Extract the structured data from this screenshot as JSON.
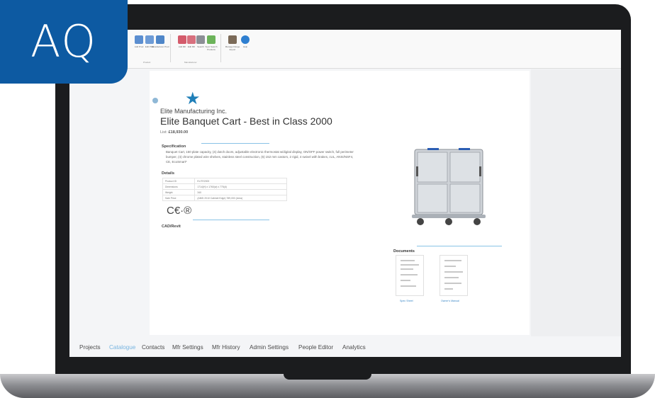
{
  "logo": {
    "text": "AQ",
    "color": "#0d5aa2"
  },
  "ribbon": {
    "buttons": [
      {
        "label": "Add Prod",
        "icon": "catalogue-icon"
      },
      {
        "label": "Edit Prod",
        "icon": "catalogue-icon"
      },
      {
        "label": "Manufacturer Prod",
        "icon": "catalogue-icon"
      },
      {
        "label": "Add Mfr",
        "icon": "cart-icon"
      },
      {
        "label": "Edit Mfr",
        "icon": "cart-icon"
      },
      {
        "label": "Search",
        "icon": "cart-icon"
      },
      {
        "label": "Sync Search Products",
        "icon": "user-search-icon"
      },
      {
        "label": "Manage Range Export",
        "icon": "person-icon"
      },
      {
        "label": "Help",
        "icon": "help-icon"
      }
    ],
    "groups": [
      "Product",
      "Manufacturer"
    ]
  },
  "product": {
    "manufacturer": "Elite Manufacturing Inc.",
    "title": "Elite Banquet Cart - Best in Class 2000",
    "price_label": "List:",
    "price": "£18,930.00",
    "spec_heading": "Specification",
    "spec_text": "Banquet Cart, 150 plate capacity, (4) dutch doors, adjustable electronic thermostat w/digital display, ON/OFF power switch, full perimeter bumper, (4) chrome plated wire shelves, stainless steel construction, (6) 152 mm castors, 2 rigid, 4 swivel with brakes, cUL, ANSI/NSF4, CE, EcoSmart*",
    "details_heading": "Details",
    "details": [
      {
        "k": "Product ID",
        "v": "ELITE2000"
      },
      {
        "k": "Dimensions",
        "v": "1714(H) x 1760(w) x 775(d)"
      },
      {
        "k": "Weight",
        "v": "340"
      },
      {
        "k": "Sale Price",
        "v": "(ANSI 2010 Cabinet Edge) 789,000 (Area)"
      }
    ],
    "cert_marks": "C€·®",
    "cad_heading": "CAD/Revit"
  },
  "documents": {
    "heading": "Documents",
    "items": [
      {
        "label": "Spec Sheet"
      },
      {
        "label": "Owner's Manual"
      }
    ]
  },
  "bottom_nav": {
    "items": [
      "Projects",
      "Catalogue",
      "Contacts",
      "Mfr Settings",
      "Mfr History",
      "Admin Settings",
      "People Editor",
      "Analytics"
    ],
    "active": "Catalogue",
    "active_color": "#76b4e0"
  }
}
